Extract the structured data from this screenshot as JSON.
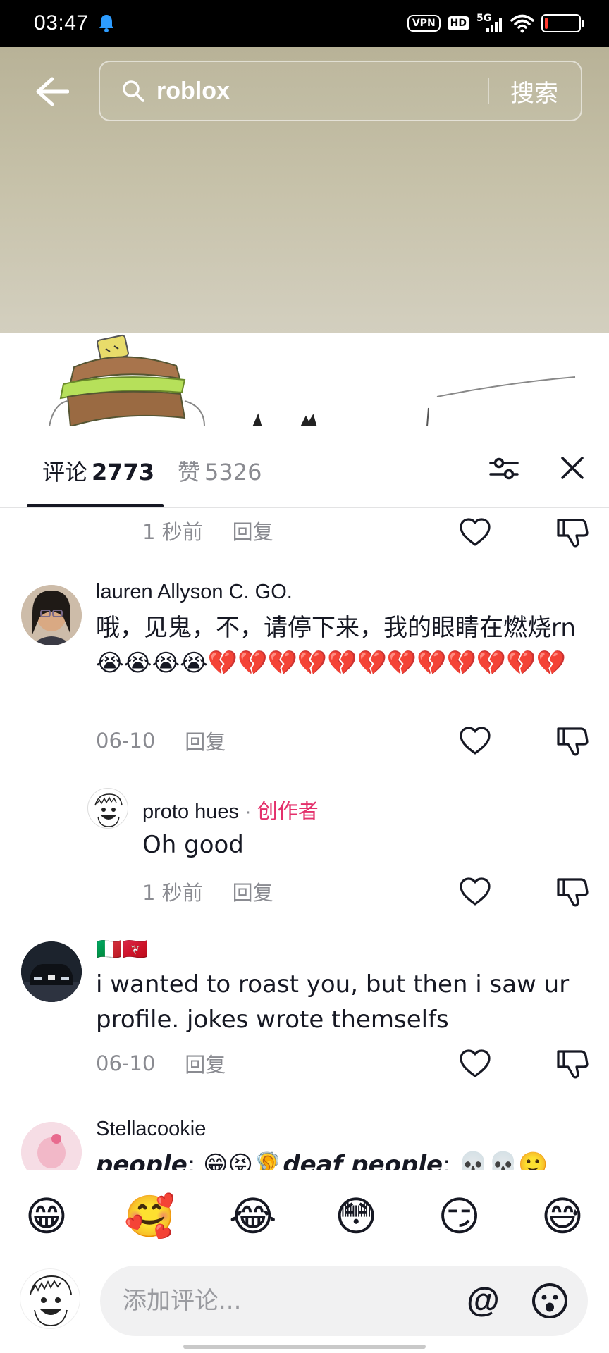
{
  "status_bar": {
    "time": "03:47",
    "vpn": "VPN",
    "hd": "HD",
    "network": "5G",
    "battery_level": 0.08,
    "battery_color": "#ff3b30"
  },
  "search": {
    "query": "roblox",
    "button_label": "搜索"
  },
  "comments_header": {
    "comments_label": "评论",
    "comments_count": "2773",
    "likes_label": "赞",
    "likes_count": "5326"
  },
  "comments": [
    {
      "time": "1 秒前",
      "reply_label": "回复"
    },
    {
      "user": "lauren Allyson C. GO.",
      "text": "哦，见鬼，不，请停下来，我的眼睛在燃烧rn😭😭😭😭💔💔💔💔💔💔💔💔💔💔💔💔",
      "date": "06-10",
      "reply_label": "回复"
    },
    {
      "user": "proto hues",
      "creator_label": "创作者",
      "text": "Oh good",
      "time": "1 秒前",
      "reply_label": "回复"
    },
    {
      "user": "🇮🇹🇮🇲",
      "text": "i wanted to roast you, but then i saw ur profile. jokes wrote themselfs",
      "date": "06-10",
      "reply_label": "回复"
    },
    {
      "user": "Stellacookie",
      "text_part1": "people",
      "text_part2": ": 😁😝🦻",
      "text_part3": "deaf people",
      "text_part4": ": 💀💀🙂"
    }
  ],
  "emoji_bar": [
    "😁",
    "🥰",
    "😂",
    "😳",
    "😏",
    "😅"
  ],
  "comment_input": {
    "placeholder": "添加评论...",
    "at_symbol": "@"
  },
  "colors": {
    "accent_creator": "#e4306b",
    "text_primary": "#161823",
    "text_secondary": "#8a8b91"
  }
}
